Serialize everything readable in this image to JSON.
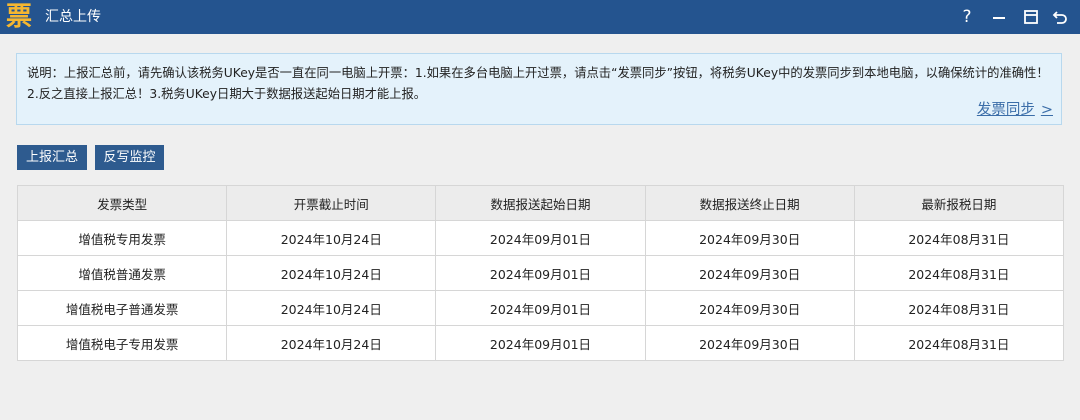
{
  "window": {
    "title": "汇总上传",
    "logo_char": "票"
  },
  "notice": {
    "text": "说明：上报汇总前，请先确认该税务UKey是否一直在同一电脑上开票：1.如果在多台电脑上开过票，请点击“发票同步”按钮，将税务UKey中的发票同步到本地电脑，以确保统计的准确性！2.反之直接上报汇总！3.税务UKey日期大于数据报送起始日期才能上报。",
    "sync_link": "发票同步",
    "sync_arrow": ">"
  },
  "toolbar": {
    "report_label": "上报汇总",
    "monitor_label": "反写监控"
  },
  "table": {
    "headers": [
      "发票类型",
      "开票截止时间",
      "数据报送起始日期",
      "数据报送终止日期",
      "最新报税日期"
    ],
    "rows": [
      [
        "增值税专用发票",
        "2024年10月24日",
        "2024年09月01日",
        "2024年09月30日",
        "2024年08月31日"
      ],
      [
        "增值税普通发票",
        "2024年10月24日",
        "2024年09月01日",
        "2024年09月30日",
        "2024年08月31日"
      ],
      [
        "增值税电子普通发票",
        "2024年10月24日",
        "2024年09月01日",
        "2024年09月30日",
        "2024年08月31日"
      ],
      [
        "增值税电子专用发票",
        "2024年10月24日",
        "2024年09月01日",
        "2024年09月30日",
        "2024年08月31日"
      ]
    ]
  },
  "icons": {
    "help": "?",
    "minimize": "minimize-icon",
    "maximize": "maximize-icon",
    "back": "back-icon"
  },
  "colors": {
    "titlebar": "#24548f",
    "logo": "#f5b731",
    "button": "#2e5b8f",
    "notice_bg": "#e4f2fb",
    "link": "#3b6da8"
  }
}
